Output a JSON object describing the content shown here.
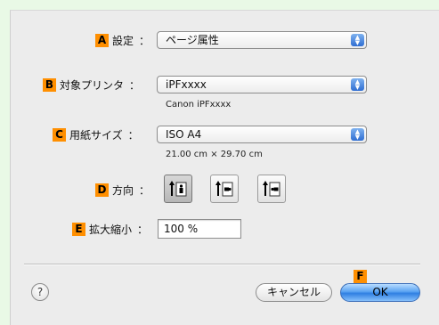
{
  "dialog": {
    "settings": {
      "badge": "A",
      "label": "設定",
      "colon": "：",
      "value": "ページ属性"
    },
    "printer": {
      "badge": "B",
      "label": "対象プリンタ",
      "colon": "：",
      "value": "iPFxxxx",
      "sub": "Canon iPFxxxx"
    },
    "paper_size": {
      "badge": "C",
      "label": "用紙サイズ",
      "colon": "：",
      "value": "ISO A4",
      "sub": "21.00 cm × 29.70 cm"
    },
    "orientation": {
      "badge": "D",
      "label": "方向",
      "colon": "：",
      "options": [
        "portrait",
        "landscape-left",
        "landscape-right"
      ],
      "selected": "portrait"
    },
    "scale": {
      "badge": "E",
      "label": "拡大縮小",
      "colon": "：",
      "value": "100 %"
    },
    "help_label": "?",
    "cancel_label": "キャンセル",
    "ok_badge": "F",
    "ok_label": "OK"
  },
  "colors": {
    "badge": "#ff8f00",
    "background": "#e9f9e6",
    "dialog": "#ececec",
    "ok_button": "#2f7fe2"
  }
}
